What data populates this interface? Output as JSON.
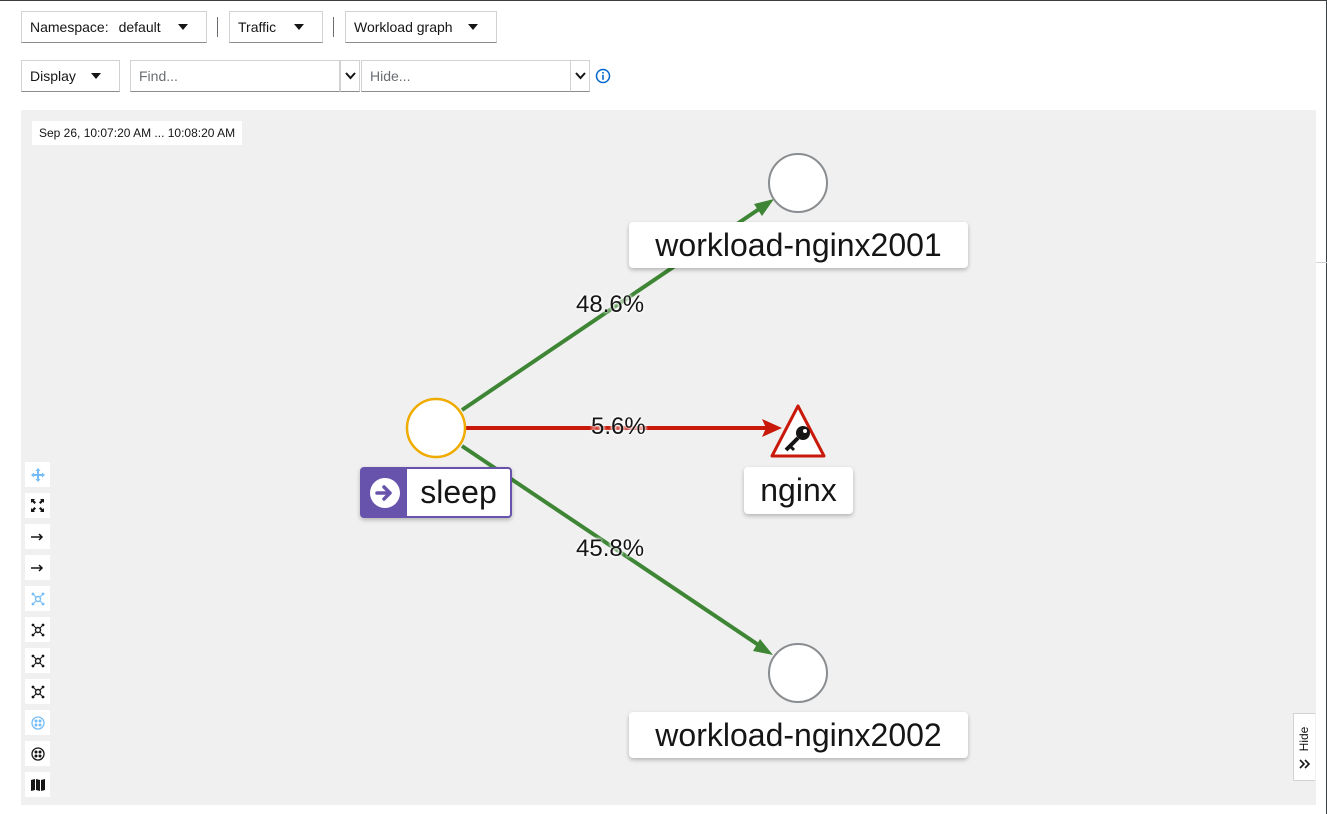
{
  "toolbar": {
    "namespace_label": "Namespace:",
    "namespace_value": "default",
    "traffic_label": "Traffic",
    "graph_type_label": "Workload graph",
    "display_label": "Display",
    "find_placeholder": "Find...",
    "hide_placeholder": "Hide..."
  },
  "graph": {
    "timestamp": "Sep 26, 10:07:20 AM ... 10:08:20 AM",
    "nodes": {
      "source": "sleep",
      "target_1": "workload-nginx2001",
      "target_2": "nginx",
      "target_3": "workload-nginx2002"
    },
    "edges": {
      "to_target_1": "48.6%",
      "to_target_2": "5.6%",
      "to_target_3": "45.8%"
    },
    "colors": {
      "healthy_edge": "#3e8635",
      "failure_edge": "#c9190b",
      "source_border": "#f0ab00",
      "app_badge": "#6753ac"
    }
  },
  "side_panel": {
    "hide_label": "Hide"
  }
}
